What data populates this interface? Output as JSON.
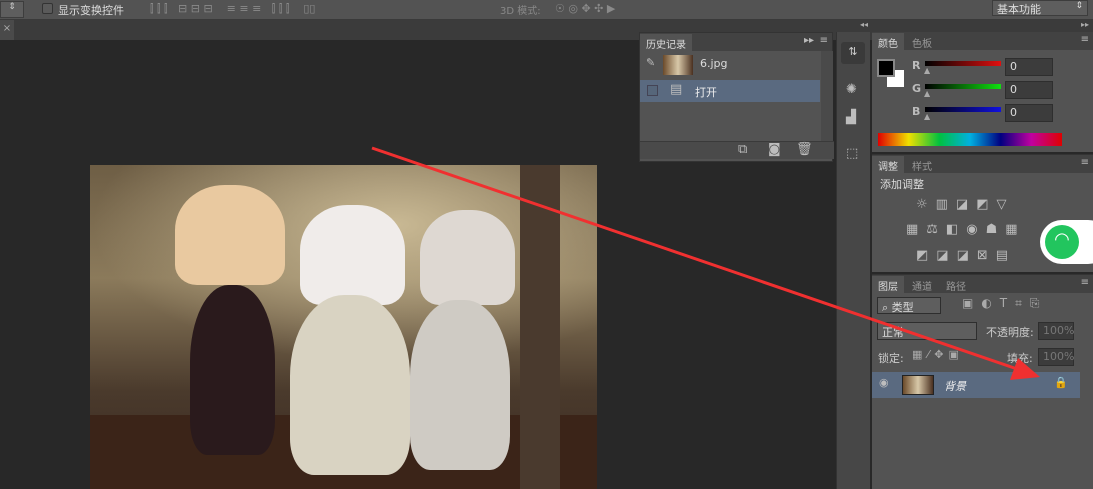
{
  "options_bar": {
    "show_transform_controls": "显示变换控件",
    "mode_3d": "3D 模式:",
    "workspace": "基本功能"
  },
  "document_tab": {
    "close": "×"
  },
  "history_panel": {
    "tab": "历史记录",
    "snapshot": "6.jpg",
    "items": [
      {
        "label": "打开"
      }
    ]
  },
  "color_panel": {
    "tabs": [
      "颜色",
      "色板"
    ],
    "channels": [
      {
        "label": "R",
        "value": "0",
        "color": "#e01010"
      },
      {
        "label": "G",
        "value": "0",
        "color": "#10e010"
      },
      {
        "label": "B",
        "value": "0",
        "color": "#1010e0"
      }
    ]
  },
  "adjustments_panel": {
    "tabs": [
      "调整",
      "样式"
    ],
    "title": "添加调整"
  },
  "layers_panel": {
    "tabs": [
      "图层",
      "通道",
      "路径"
    ],
    "filter": "类型",
    "blend_mode": "正常",
    "opacity_label": "不透明度:",
    "opacity": "100%",
    "lock_label": "锁定:",
    "fill_label": "填充:",
    "fill": "100%",
    "layers": [
      {
        "name": "背景"
      }
    ]
  }
}
